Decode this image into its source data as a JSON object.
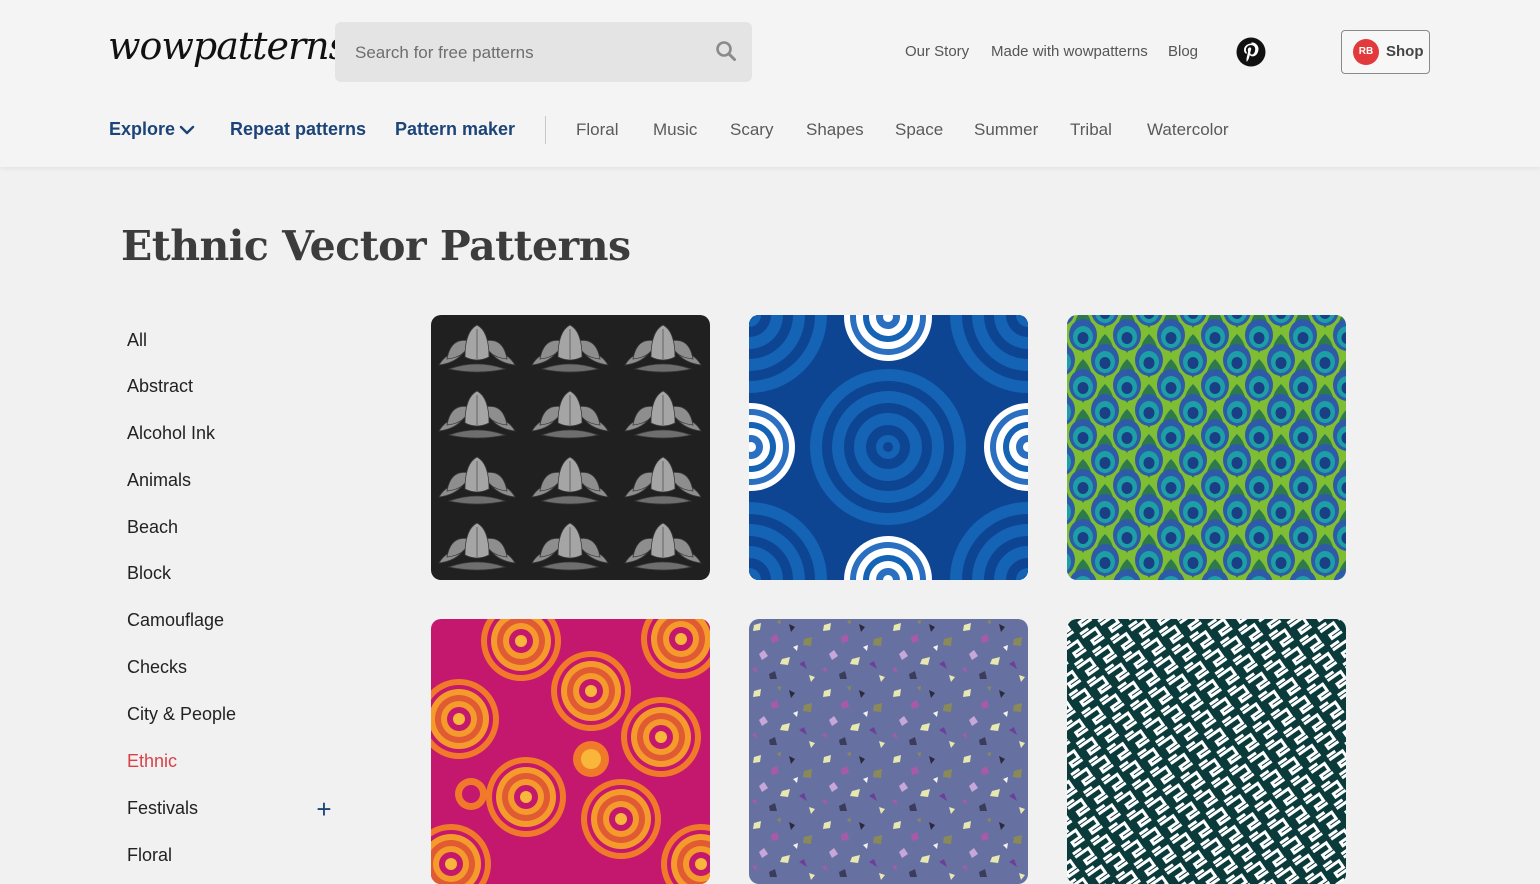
{
  "header": {
    "logo_text": "wowpatterns",
    "search": {
      "placeholder": "Search for free patterns",
      "value": ""
    },
    "top_links": [
      "Our Story",
      "Made with wowpatterns",
      "Blog"
    ],
    "shop_label": "Shop",
    "shop_icon_text": "RB"
  },
  "nav": {
    "explore": "Explore",
    "repeat": "Repeat patterns",
    "maker": "Pattern maker",
    "categories": [
      "Floral",
      "Music",
      "Scary",
      "Shapes",
      "Space",
      "Summer",
      "Tribal",
      "Watercolor"
    ]
  },
  "page": {
    "title": "Ethnic Vector Patterns"
  },
  "sidebar": {
    "items": [
      "All",
      "Abstract",
      "Alcohol Ink",
      "Animals",
      "Beach",
      "Block",
      "Camouflage",
      "Checks",
      "City & People",
      "Ethnic",
      "Festivals",
      "Floral"
    ],
    "active": "Ethnic"
  },
  "icons": {
    "search": "search-icon",
    "chevron": "chevron-down-icon",
    "pinterest": "pinterest-icon",
    "shop": "redbubble-icon",
    "expand": "plus-icon"
  },
  "colors": {
    "nav_primary": "#1d4478",
    "active_category": "#d94148",
    "pinterest": "#111111",
    "shop_badge": "#e1393c"
  },
  "patterns": [
    {
      "id": "lotus-dark",
      "bg": "#202020"
    },
    {
      "id": "mandala-blue",
      "bg": "#0d4592"
    },
    {
      "id": "peacock-feather",
      "bg": "#7fbd32"
    },
    {
      "id": "mandala-magenta",
      "bg": "#c4176e"
    },
    {
      "id": "terrazzo-slate",
      "bg": "#6671a1"
    },
    {
      "id": "geometric-maze",
      "bg": "#0b3a3a"
    }
  ]
}
